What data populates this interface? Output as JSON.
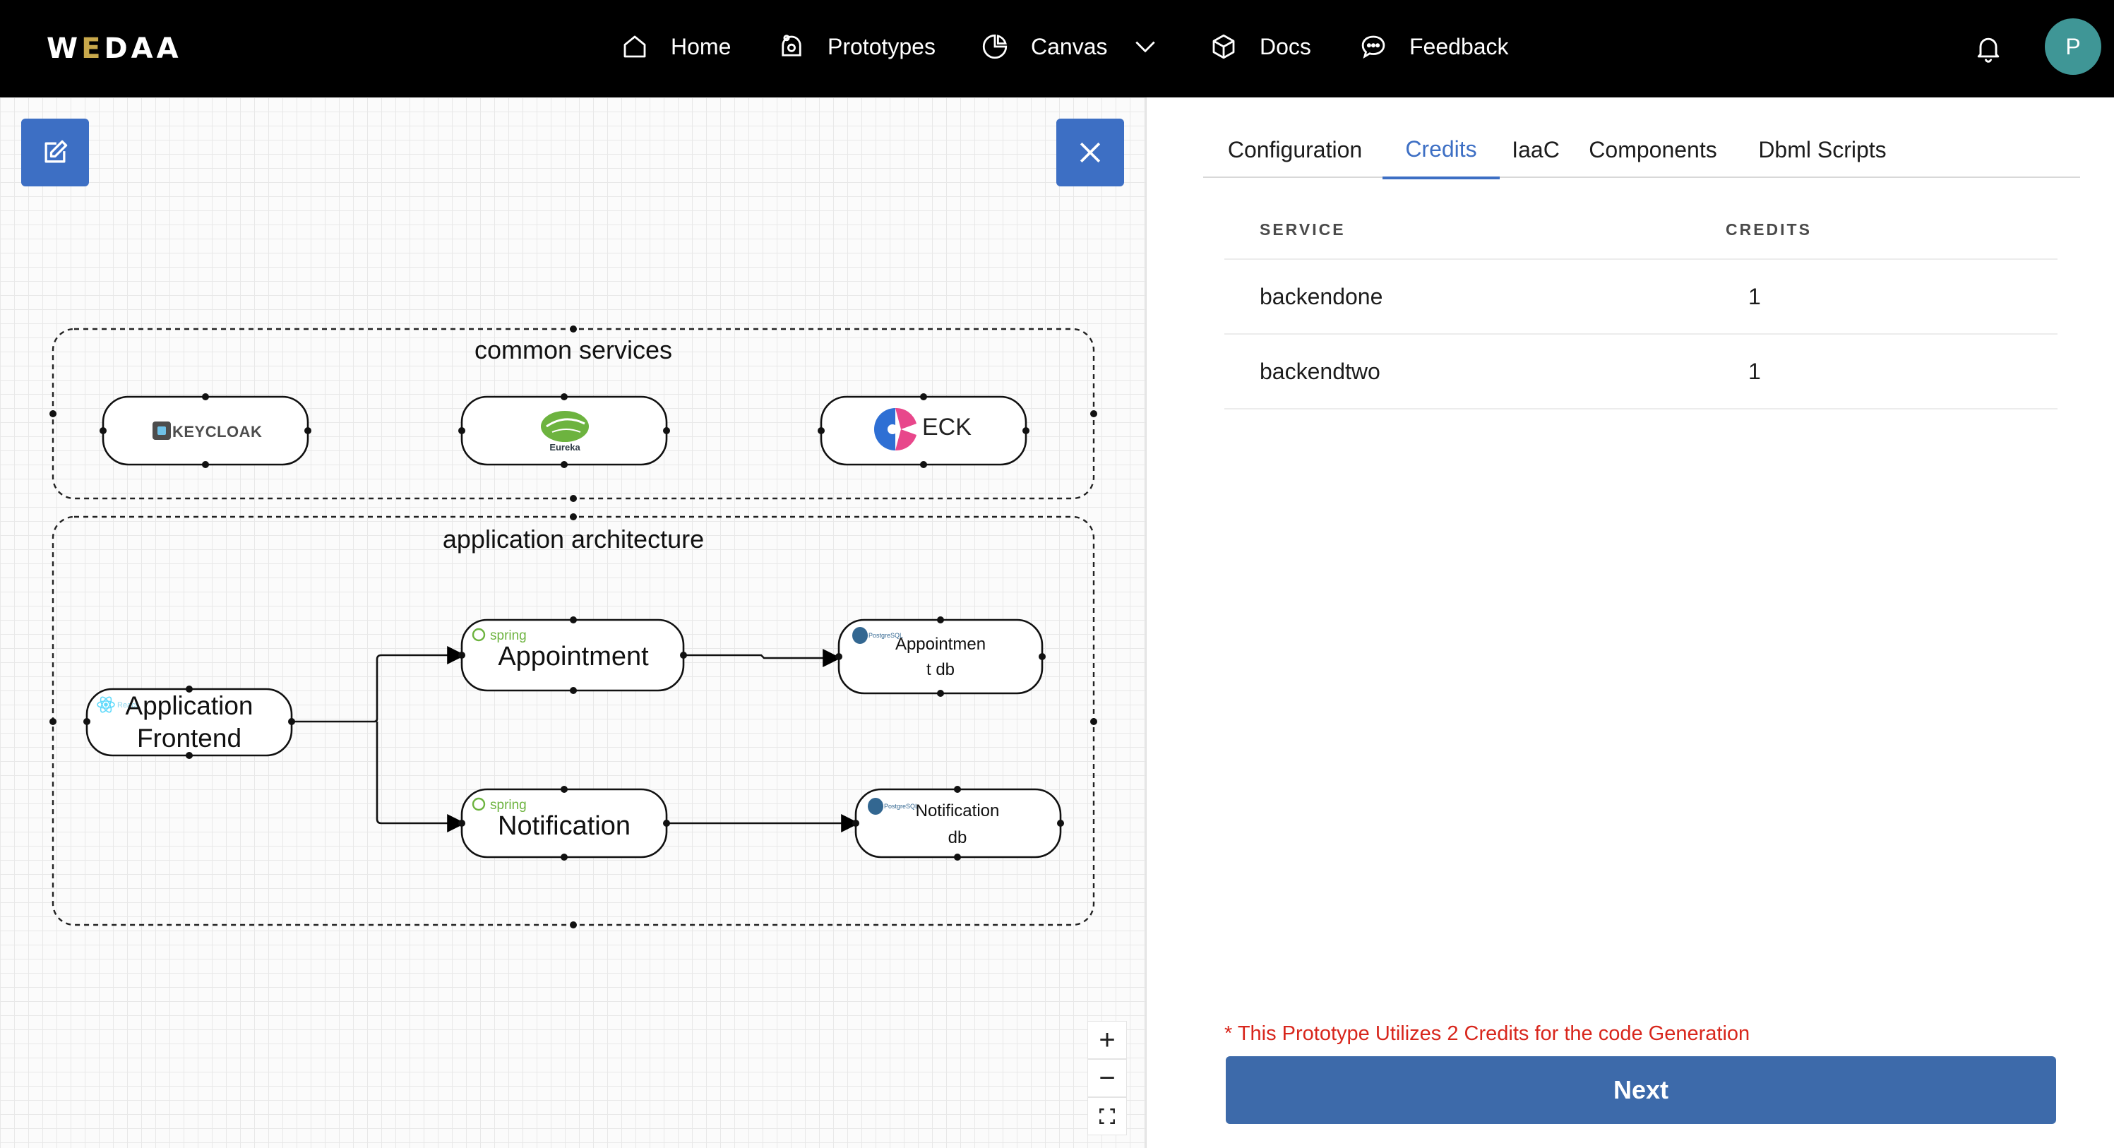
{
  "app": {
    "logo_letters": [
      "W",
      "E",
      "D",
      "A",
      "A"
    ],
    "brand_accent_color": "#c8a84b",
    "accent_color": "#3d6fc4"
  },
  "nav": {
    "items": [
      {
        "label": "Home",
        "icon": "home-icon"
      },
      {
        "label": "Prototypes",
        "icon": "prototypes-icon"
      },
      {
        "label": "Canvas",
        "icon": "canvas-icon",
        "dropdown": true
      },
      {
        "label": "Docs",
        "icon": "cube-icon"
      },
      {
        "label": "Feedback",
        "icon": "chat-icon"
      }
    ],
    "notification_icon": "bell-icon",
    "avatar_initial": "P"
  },
  "canvas": {
    "toolbar_icons": [
      "edit-icon",
      "close-icon"
    ],
    "zoom_controls": [
      "+",
      "−",
      "fit-view-icon"
    ],
    "groups": {
      "common": "common services",
      "app": "application architecture"
    },
    "services": {
      "keycloak_logo": "KEYCLOAK",
      "eureka_logo": "Eureka",
      "eck_logo": "ECK"
    },
    "nodes": {
      "frontend": [
        "Application",
        "Frontend"
      ],
      "appointment": "Appointment",
      "notification": "Notification",
      "appointment_db": [
        "Appointmen",
        "t db"
      ],
      "notification_db": [
        "Notification",
        "db"
      ],
      "spring_badge": "spring",
      "postgres_badge": "PostgreSQL",
      "react_badge": "React"
    }
  },
  "panel": {
    "tabs": [
      "Configuration",
      "Credits",
      "IaaC",
      "Components",
      "Dbml Scripts"
    ],
    "active_tab": "Credits",
    "table": {
      "headers": [
        "SERVICE",
        "CREDITS"
      ],
      "rows": [
        {
          "service": "backendone",
          "credits": "1"
        },
        {
          "service": "backendtwo",
          "credits": "1"
        }
      ]
    },
    "credits_note": "* This Prototype Utilizes 2 Credits for the code Generation",
    "next_label": "Next"
  }
}
